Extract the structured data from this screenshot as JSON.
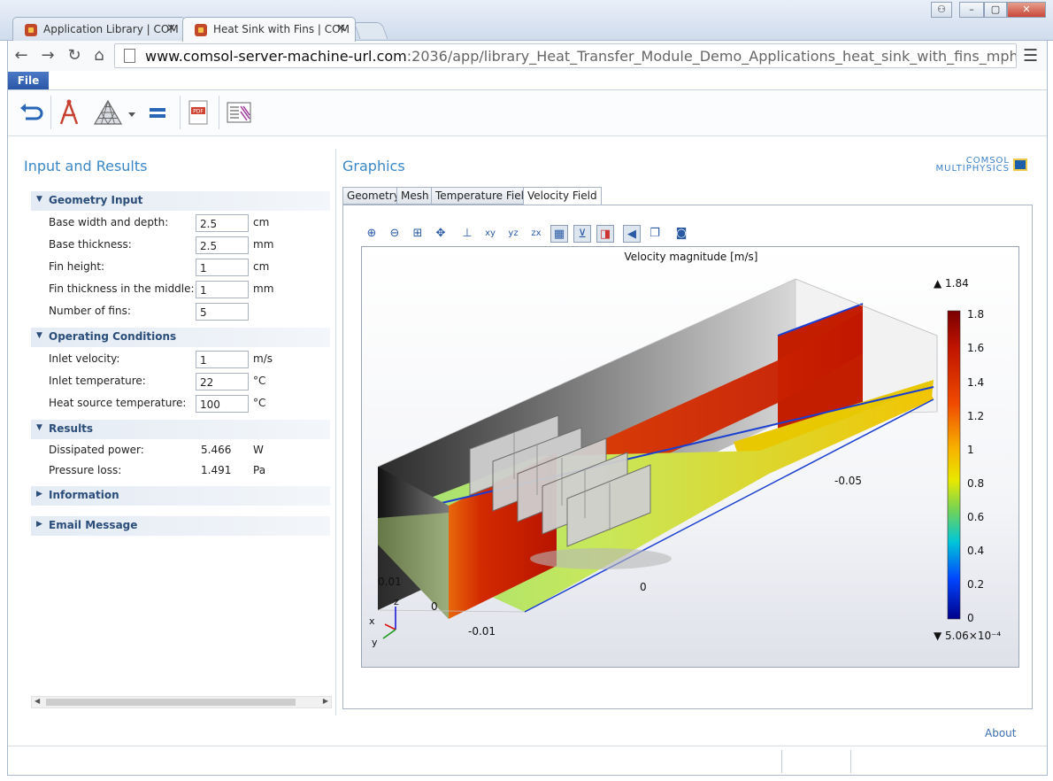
{
  "browser": {
    "tabs": [
      {
        "title": "Application Library | COM",
        "active": false
      },
      {
        "title": "Heat Sink with Fins | COM",
        "active": true
      }
    ],
    "url_host": "www.comsol-server-machine-url.com",
    "url_path": ":2036/app/library_Heat_Transfer_Module_Demo_Applications_heat_sink_with_fins_mph"
  },
  "menu": {
    "file_label": "File"
  },
  "toolbar": {
    "icons": [
      "undo-icon",
      "compass-icon",
      "mesh-icon",
      "dropdown-arrow-icon",
      "equals-icon",
      "pdf-report-icon",
      "report-icon"
    ]
  },
  "left": {
    "title": "Input and Results",
    "geometry": {
      "header": "Geometry Input",
      "rows": [
        {
          "label": "Base width and depth:",
          "value": "2.5",
          "unit": "cm"
        },
        {
          "label": "Base thickness:",
          "value": "2.5",
          "unit": "mm"
        },
        {
          "label": "Fin height:",
          "value": "1",
          "unit": "cm"
        },
        {
          "label": "Fin thickness in the middle:",
          "value": "1",
          "unit": "mm"
        },
        {
          "label": "Number of fins:",
          "value": "5",
          "unit": ""
        }
      ]
    },
    "operating": {
      "header": "Operating Conditions",
      "rows": [
        {
          "label": "Inlet velocity:",
          "value": "1",
          "unit": "m/s"
        },
        {
          "label": "Inlet temperature:",
          "value": "22",
          "unit": "°C"
        },
        {
          "label": "Heat source temperature:",
          "value": "100",
          "unit": "°C"
        }
      ]
    },
    "results": {
      "header": "Results",
      "rows": [
        {
          "label": "Dissipated power:",
          "value": "5.466",
          "unit": "W"
        },
        {
          "label": "Pressure loss:",
          "value": "1.491",
          "unit": "Pa"
        }
      ]
    },
    "information": {
      "header": "Information"
    },
    "email": {
      "header": "Email Message"
    }
  },
  "graphics": {
    "title": "Graphics",
    "logo_line1": "COMSOL",
    "logo_line2": "MULTIPHYSICS",
    "tabs": [
      "Geometry",
      "Mesh",
      "Temperature Field",
      "Velocity Field"
    ],
    "active_tab": "Velocity Field",
    "plot_title": "Velocity magnitude [m/s]",
    "colorbar": {
      "max_label": "▲ 1.84",
      "min_label": "▼ 5.06×10⁻⁴",
      "ticks": [
        "1.8",
        "1.6",
        "1.4",
        "1.2",
        "1",
        "0.8",
        "0.6",
        "0.4",
        "0.2",
        "0"
      ]
    },
    "axis_labels": [
      "-0.05",
      "0",
      "0.01",
      "0",
      "-0.01"
    ],
    "triad": {
      "x": "x",
      "y": "y",
      "z": "z"
    }
  },
  "footer": {
    "about": "About"
  },
  "colors": {
    "accent": "#3a87c7",
    "section_text": "#2a4d7a",
    "file_menu": "#2a56a6"
  }
}
